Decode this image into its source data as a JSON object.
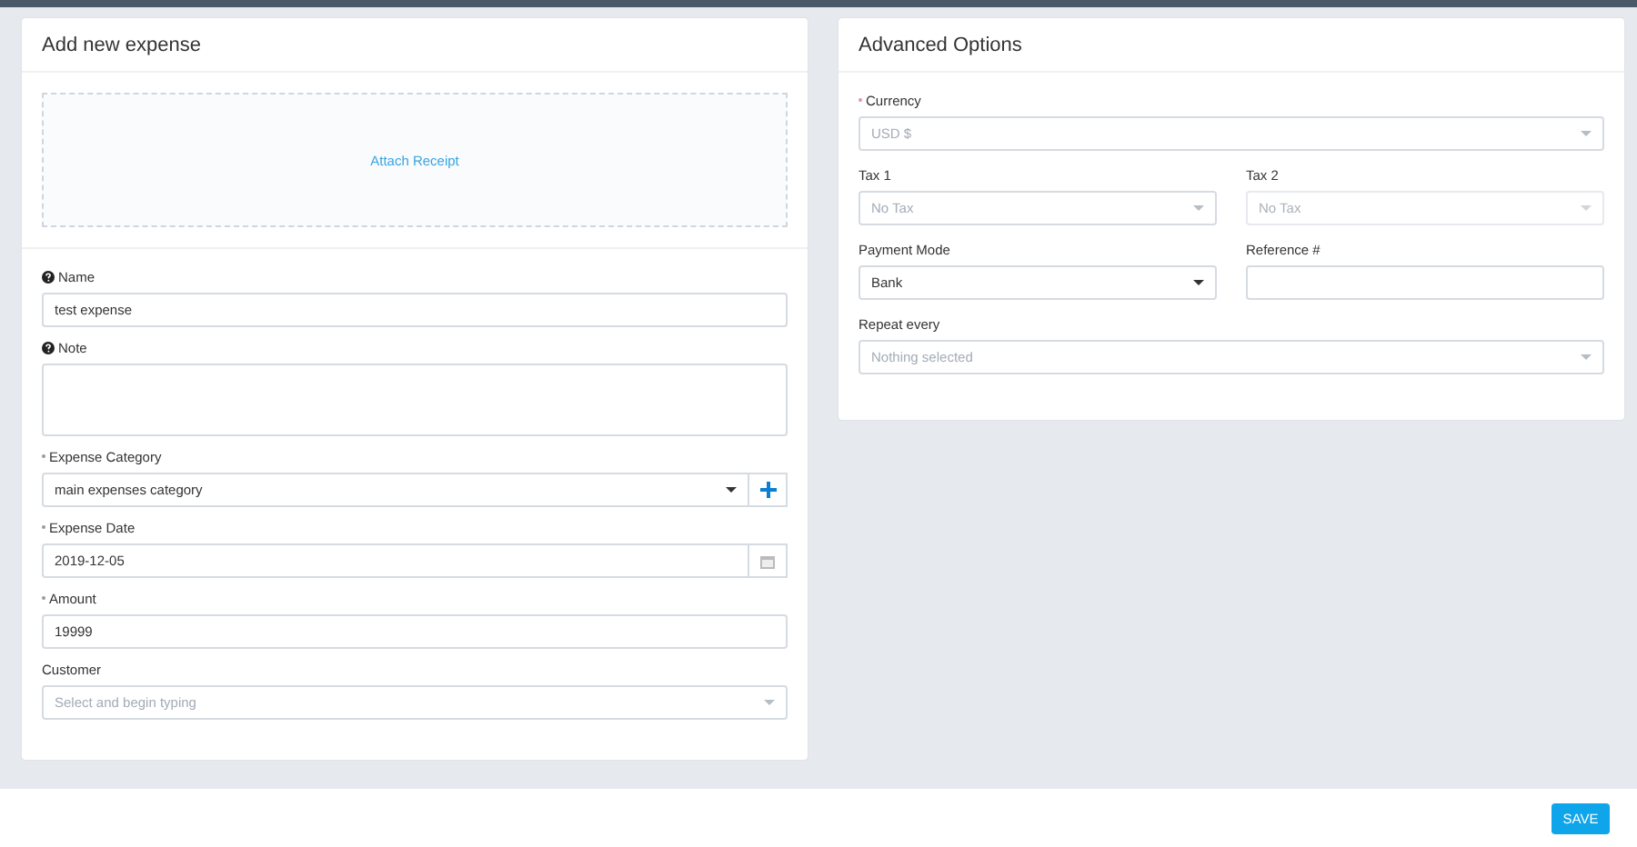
{
  "expense_card": {
    "title": "Add new expense",
    "attach_link": "Attach Receipt",
    "fields": [
      {
        "label": "Name",
        "help": true,
        "required": false,
        "kind": "text",
        "value": "test expense"
      },
      {
        "label": "Note",
        "help": true,
        "required": false,
        "kind": "textarea"
      },
      {
        "label": "Expense Category",
        "help": false,
        "required": true,
        "kind": "select_add",
        "value": "main expenses category"
      },
      {
        "label": "Expense Date",
        "help": false,
        "required": true,
        "kind": "date",
        "value": "2019-12-05"
      },
      {
        "label": "Amount",
        "help": false,
        "required": true,
        "kind": "text",
        "value": "19999"
      },
      {
        "label": "Customer",
        "help": false,
        "required": false,
        "kind": "select",
        "placeholder": "Select and begin typing"
      }
    ]
  },
  "options_card": {
    "title": "Advanced Options",
    "rows": [
      [
        {
          "label": "Currency",
          "required": true,
          "kind": "select",
          "placeholder": "USD $",
          "disabled": false
        }
      ],
      [
        {
          "label": "Tax 1",
          "required": false,
          "kind": "select",
          "placeholder": "No Tax",
          "disabled": false
        },
        {
          "label": "Tax 2",
          "required": false,
          "kind": "select",
          "placeholder": "No Tax",
          "disabled": true
        }
      ],
      [
        {
          "label": "Payment Mode",
          "required": false,
          "kind": "select",
          "value": "Bank",
          "disabled": false
        },
        {
          "label": "Reference #",
          "required": false,
          "kind": "text",
          "disabled": false
        }
      ],
      [
        {
          "label": "Repeat every",
          "required": false,
          "kind": "select",
          "placeholder": "Nothing selected",
          "disabled": false
        }
      ]
    ]
  },
  "save_button": "SAVE"
}
